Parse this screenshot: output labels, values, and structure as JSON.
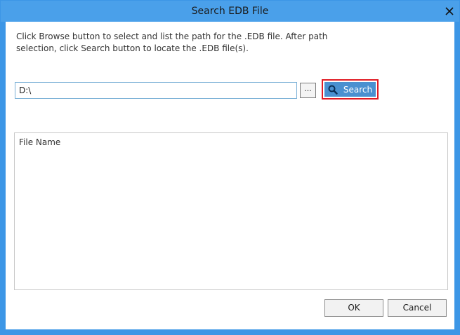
{
  "window": {
    "title": "Search EDB File"
  },
  "instructions": "Click Browse button to select and list the path for the .EDB file. After path\nselection, click Search button to locate the .EDB file(s).",
  "path_field": {
    "value": "D:\\"
  },
  "browse_button": {
    "label": "..."
  },
  "search_button": {
    "label": "Search",
    "icon": "search-icon"
  },
  "results": {
    "columns": [
      "File Name"
    ]
  },
  "footer": {
    "ok_label": "OK",
    "cancel_label": "Cancel"
  },
  "colors": {
    "title_bar": "#4aa0ea",
    "accent": "#4a90d0",
    "highlight_border": "#e01b24"
  }
}
